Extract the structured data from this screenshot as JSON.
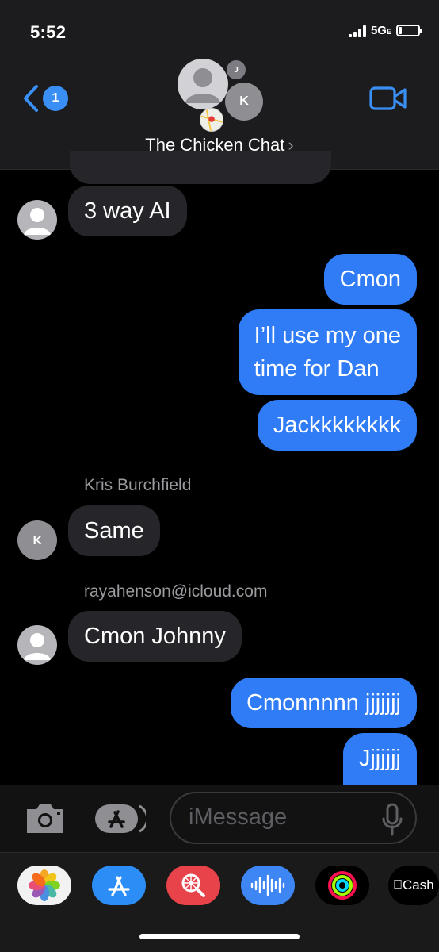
{
  "status": {
    "time": "5:52",
    "network": "5G",
    "network_sub": "E"
  },
  "header": {
    "back_badge": "1",
    "title": "The Chicken Chat",
    "avatar_j": "J",
    "avatar_k": "K"
  },
  "messages": [
    {
      "text": "3 way AI",
      "direction": "in"
    },
    {
      "text": "Cmon",
      "direction": "out"
    },
    {
      "text": "I’ll use my one",
      "text2": "time for Dan",
      "direction": "out"
    },
    {
      "text": "Jackkkkkkkk",
      "direction": "out"
    },
    {
      "sender": "Kris Burchfield",
      "text": "Same",
      "direction": "in",
      "avatar": "K"
    },
    {
      "sender": "rayahenson@icloud.com",
      "text": "Cmon Johnny",
      "direction": "in"
    },
    {
      "text": "Cmonnnnn jjjjjjj",
      "direction": "out"
    },
    {
      "text": "Jjjjjjj",
      "direction": "out"
    }
  ],
  "input": {
    "placeholder": "iMessage"
  },
  "apps": [
    {
      "icon": "photos-icon"
    },
    {
      "icon": "app-store-icon"
    },
    {
      "icon": "images-search-icon"
    },
    {
      "icon": "audio-message-icon"
    },
    {
      "icon": "activity-icon"
    },
    {
      "icon": "apple-cash-icon",
      "label": "Cash"
    }
  ],
  "colors": {
    "accent": "#2f7cf6",
    "incoming": "#26262a",
    "header": "#1c1c1e"
  }
}
